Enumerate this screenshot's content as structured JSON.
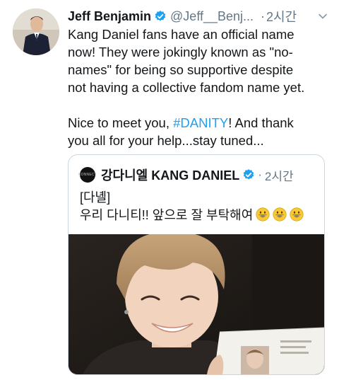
{
  "tweet": {
    "author_name": "Jeff Benjamin",
    "handle": "@Jeff__Benj...",
    "separator": "·",
    "time": "2시간",
    "line1": "Kang Daniel fans have an official name",
    "line2": "now! They were jokingly known as \"no-",
    "line3": "names\" for being so supportive despite",
    "line4": "not having a collective fandom name yet.",
    "line5_before": "Nice to meet you, ",
    "hashtag": "#DANITY",
    "line5_after": "! And thank",
    "line6": "you all for your help...stay tuned..."
  },
  "quoted_tweet": {
    "author_name": "강다니엘 KANG DANIEL",
    "separator": "·",
    "time": "2시간",
    "avatar_text": "KONNECT",
    "line1": "[다녤]",
    "line2": "우리 다니티!! 앞으로 잘 부탁해여"
  },
  "colors": {
    "link": "#1da1f2",
    "verified": "#1da1f2",
    "secondary_text": "#657786"
  },
  "icons": [
    "verified-badge-icon",
    "chevron-down-icon",
    "grinning-emoji-icon"
  ]
}
